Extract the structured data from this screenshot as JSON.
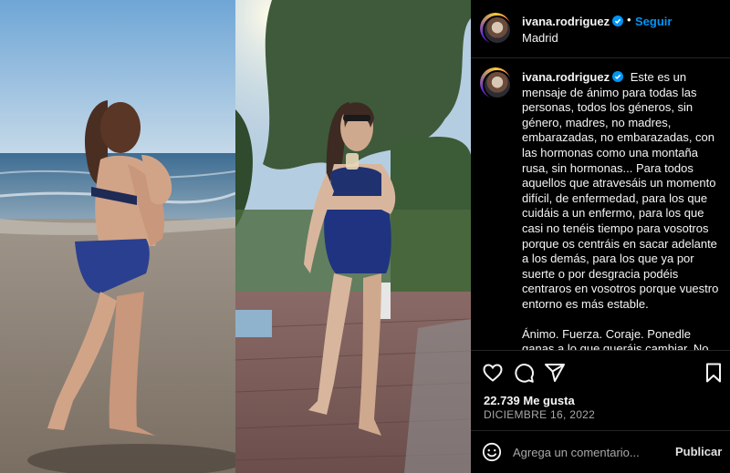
{
  "post": {
    "username": "ivana.rodriguez",
    "follow_label": "Seguir",
    "separator": "•",
    "location": "Madrid",
    "caption_paragraph_1": "Este es un mensaje de ánimo para todas las personas, todos los géneros, sin género, madres, no madres, embarazadas, no embarazadas, con las hormonas como una montaña rusa, sin hormonas... Para todos aquellos que atravesáis un momento difícil, de enfermedad, para los que cuidáis a un enfermo, para los que casi no tenéis tiempo para vosotros porque os centráis en sacar adelante a los demás, para los que ya por suerte o por desgracia podéis centraros en vosotros porque vuestro entorno es más estable.",
    "caption_paragraph_2": "Ánimo. Fuerza. Coraje. Ponedle ganas a lo que queráis cambiar. No",
    "likes": "22.739 Me gusta",
    "date": "DICIEMBRE 16, 2022"
  },
  "comment": {
    "placeholder": "Agrega un comentario...",
    "publish_label": "Publicar"
  },
  "icons": [
    "verified-badge-icon",
    "heart-icon",
    "comment-icon",
    "share-icon",
    "bookmark-icon",
    "emoji-icon"
  ],
  "colors": {
    "accent": "#0095f6",
    "background": "#000000",
    "secondary_text": "#a8a8a8"
  }
}
